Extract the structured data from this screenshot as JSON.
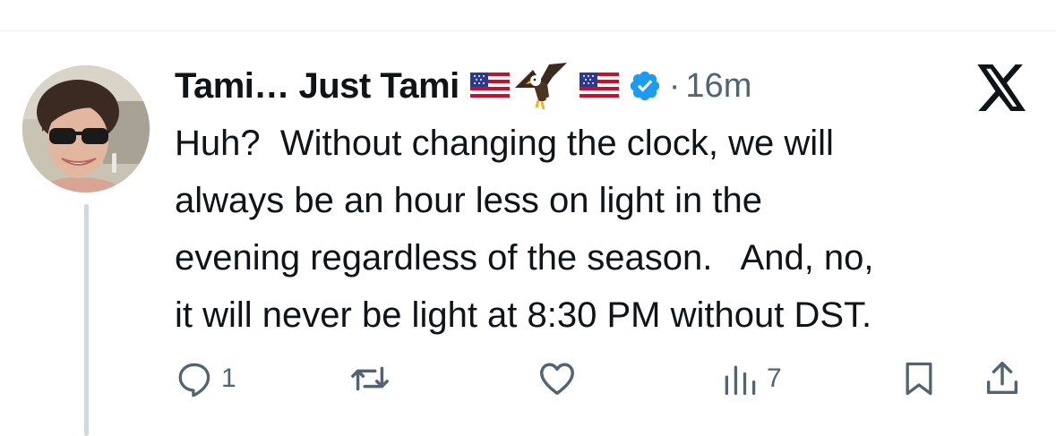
{
  "post": {
    "author_name": "Tami… Just Tami",
    "timestamp": "16m",
    "separator": "·",
    "text": "Huh?  Without changing the clock, we will\nalways be an hour less on light in the\nevening regardless of the season.   And, no,\nit will never be light at 8:30 PM without DST.",
    "verified": true,
    "name_emojis": [
      "us-flag-emoji",
      "eagle-emoji",
      "us-flag-emoji"
    ]
  },
  "actions": {
    "replies_count": "1",
    "reposts_count": "",
    "likes_count": "",
    "views_count": "7"
  },
  "icons": {
    "reply": "reply-icon",
    "repost": "repost-icon",
    "like": "heart-icon",
    "views": "views-icon",
    "bookmark": "bookmark-icon",
    "share": "share-icon",
    "brand": "x-logo-icon"
  },
  "colors": {
    "text": "#0f1419",
    "secondary": "#536471",
    "verified_blue": "#1d9bf0",
    "thread_line": "#cfd9de"
  }
}
